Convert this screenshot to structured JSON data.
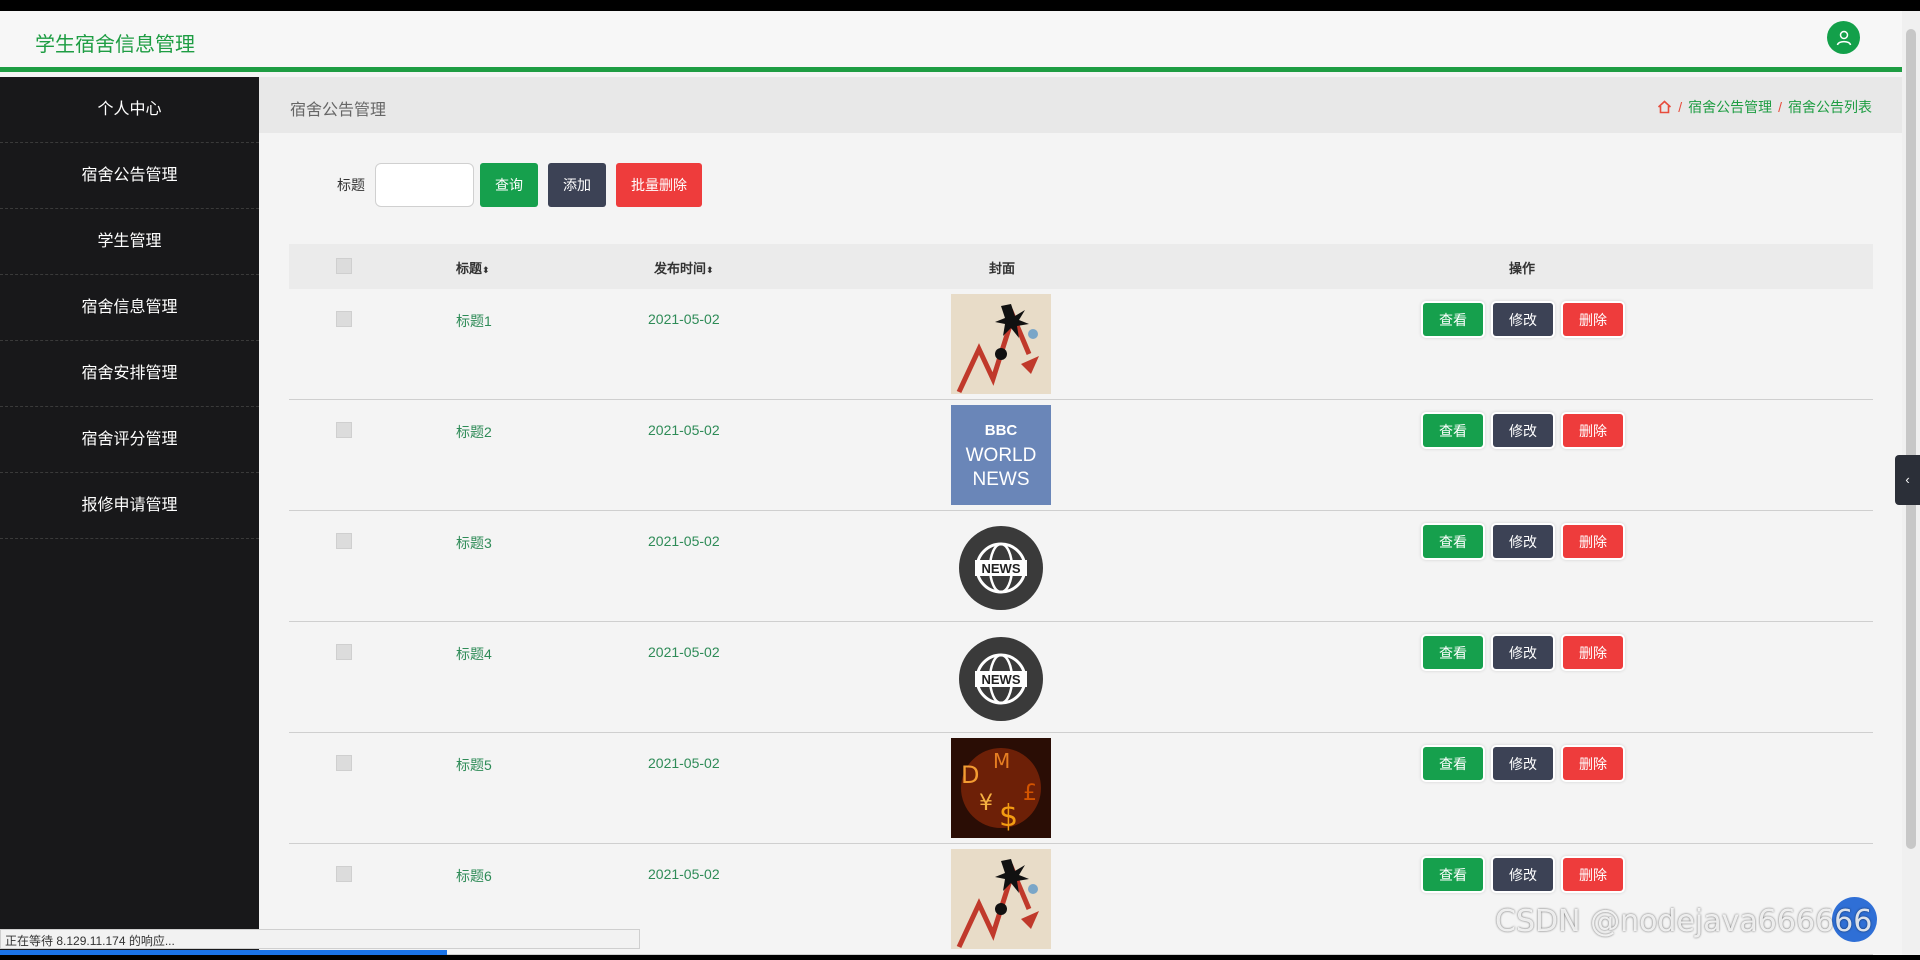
{
  "app": {
    "title": "学生宿舍信息管理"
  },
  "sidebar": {
    "items": [
      {
        "label": "个人中心"
      },
      {
        "label": "宿舍公告管理"
      },
      {
        "label": "学生管理"
      },
      {
        "label": "宿舍信息管理"
      },
      {
        "label": "宿舍安排管理"
      },
      {
        "label": "宿舍评分管理"
      },
      {
        "label": "报修申请管理"
      }
    ]
  },
  "breadcrumb": {
    "page_title": "宿舍公告管理",
    "items": [
      "宿舍公告管理",
      "宿舍公告列表"
    ],
    "separator": "/"
  },
  "search": {
    "label": "标题",
    "value": "",
    "query_label": "查询",
    "add_label": "添加",
    "batch_delete_label": "批量删除"
  },
  "table": {
    "headers": {
      "title": "标题",
      "time": "发布时间",
      "cover": "封面",
      "actions": "操作"
    },
    "view_label": "查看",
    "edit_label": "修改",
    "delete_label": "删除",
    "rows": [
      {
        "title": "标题1",
        "date": "2021-05-02",
        "cover": "chart-crash"
      },
      {
        "title": "标题2",
        "date": "2021-05-02",
        "cover": "bbc-world-news",
        "cover_text": [
          "BBC",
          "WORLD",
          "NEWS"
        ]
      },
      {
        "title": "标题3",
        "date": "2021-05-02",
        "cover": "news-globe",
        "cover_text": [
          "NEWS"
        ]
      },
      {
        "title": "标题4",
        "date": "2021-05-02",
        "cover": "news-globe",
        "cover_text": [
          "NEWS"
        ]
      },
      {
        "title": "标题5",
        "date": "2021-05-02",
        "cover": "currency-symbols"
      },
      {
        "title": "标题6",
        "date": "2021-05-02",
        "cover": "chart-crash"
      }
    ]
  },
  "status_bar": {
    "text": "正在等待 8.129.11.174 的响应..."
  },
  "watermark": {
    "text": "CSDN @nodejava666666"
  },
  "colors": {
    "accent": "#1e9d43",
    "sidebar": "#18181a",
    "view": "#16a04d",
    "edit": "#3c4255",
    "delete": "#ee3c3c"
  }
}
